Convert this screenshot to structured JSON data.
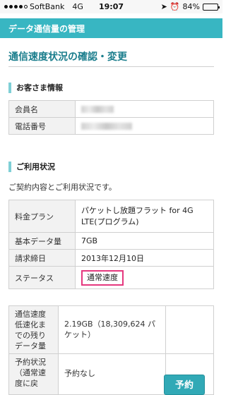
{
  "status_bar": {
    "carrier": "SoftBank",
    "network": "4G",
    "time": "19:07",
    "battery_text": "84%",
    "battery_level": 0.84,
    "signal_bars": 4,
    "icons": [
      "signal-dots-icon",
      "location-arrow-icon",
      "alarm-icon",
      "battery-icon"
    ]
  },
  "header": {
    "title": "データ通信量の管理"
  },
  "page_title": "通信速度状況の確認・変更",
  "customer": {
    "heading": "お客さま情報",
    "rows": [
      {
        "label": "会員名"
      },
      {
        "label": "電話番号"
      }
    ]
  },
  "usage_status": {
    "heading": "ご利用状況",
    "intro": "ご契約内容とご利用状況です。",
    "rows": [
      {
        "label": "料金プラン",
        "value": "パケットし放題フラット for 4G LTE(プログラム)"
      },
      {
        "label": "基本データ量",
        "value": "7GB"
      },
      {
        "label": "請求締日",
        "value": "2013年12月10日"
      },
      {
        "label": "ステータス",
        "value": "通常速度"
      }
    ]
  },
  "remaining": {
    "label": "通信速度低速化までの残りデータ量",
    "value": "2.19GB（18,309,624 パケット）"
  },
  "reservation": {
    "label": "予約状況（通常速度に戻",
    "value": "予約なし",
    "button": "予約"
  },
  "colors": {
    "accent": "#38b6c2",
    "title": "#1a7d8c",
    "highlight": "#e5387e"
  }
}
